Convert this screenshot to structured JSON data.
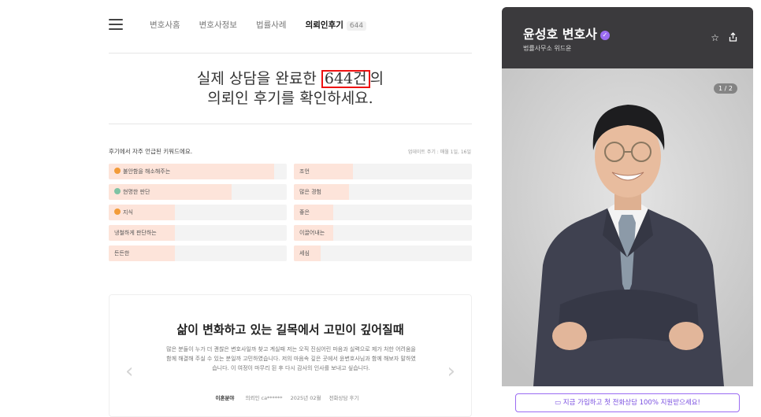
{
  "nav": {
    "tabs": [
      {
        "label": "변호사홈"
      },
      {
        "label": "변호사정보"
      },
      {
        "label": "법률사례"
      },
      {
        "label": "의뢰인후기",
        "count": "644"
      }
    ]
  },
  "headline": {
    "line1_before": "실제 상담을 완료한 ",
    "line1_highlight": "644건",
    "line1_after": "의",
    "line2": "의뢰인 후기를 확인하세요."
  },
  "keywords": {
    "title": "후기에서 자주 언급된 키워드에요.",
    "updated": "업데이트 주기 : 매월 1일, 16일",
    "items": [
      {
        "label": "불안함을 해소해주는",
        "ratio": 0.93,
        "badge": "#f29b38"
      },
      {
        "label": "조언",
        "ratio": 0.33
      },
      {
        "label": "현명한 판단",
        "ratio": 0.69,
        "badge": "#7fc3a4"
      },
      {
        "label": "많은 경험",
        "ratio": 0.31
      },
      {
        "label": "지식",
        "ratio": 0.37,
        "badge": "#f29b38"
      },
      {
        "label": "좋은",
        "ratio": 0.22
      },
      {
        "label": "냉철하게 판단하는",
        "ratio": 0.37
      },
      {
        "label": "이끌어내는",
        "ratio": 0.22
      },
      {
        "label": "든든한",
        "ratio": 0.37
      },
      {
        "label": "세심",
        "ratio": 0.15
      }
    ]
  },
  "review": {
    "title": "삶이 변화하고 있는 길목에서 고민이 깊어질때",
    "body": "많은 분들이 누가 더 괜찮은 변호사일까 찾고 계실때 저는 오직 진심어린 마음과 실력으로 제가 처한 어려움을 함께 해결해 주실 수 있는 분일까 고민하였습니다. 저의 마음속 깊은 곳에서 윤변호사님과 함께 해보자 말하였습니다. 이 여정이 마무리 된 후 다시 감사의 인사를 보내고 싶습니다.",
    "category": "이혼분야",
    "author": "의뢰인 ca******",
    "date": "2025년 02월",
    "type": "전화상담 후기"
  },
  "panel": {
    "name": "윤성호 변호사",
    "firm": "법률사무소 위드윤",
    "counter": "1 / 2",
    "cta": "지금 가입하고 첫 전화상담 100% 지원받으세요!"
  },
  "colors": {
    "accent": "#9b6cf2",
    "highlight_box": "#e11111",
    "keyword_fill": "#fde4da",
    "panel_header": "#3b3a3d"
  }
}
